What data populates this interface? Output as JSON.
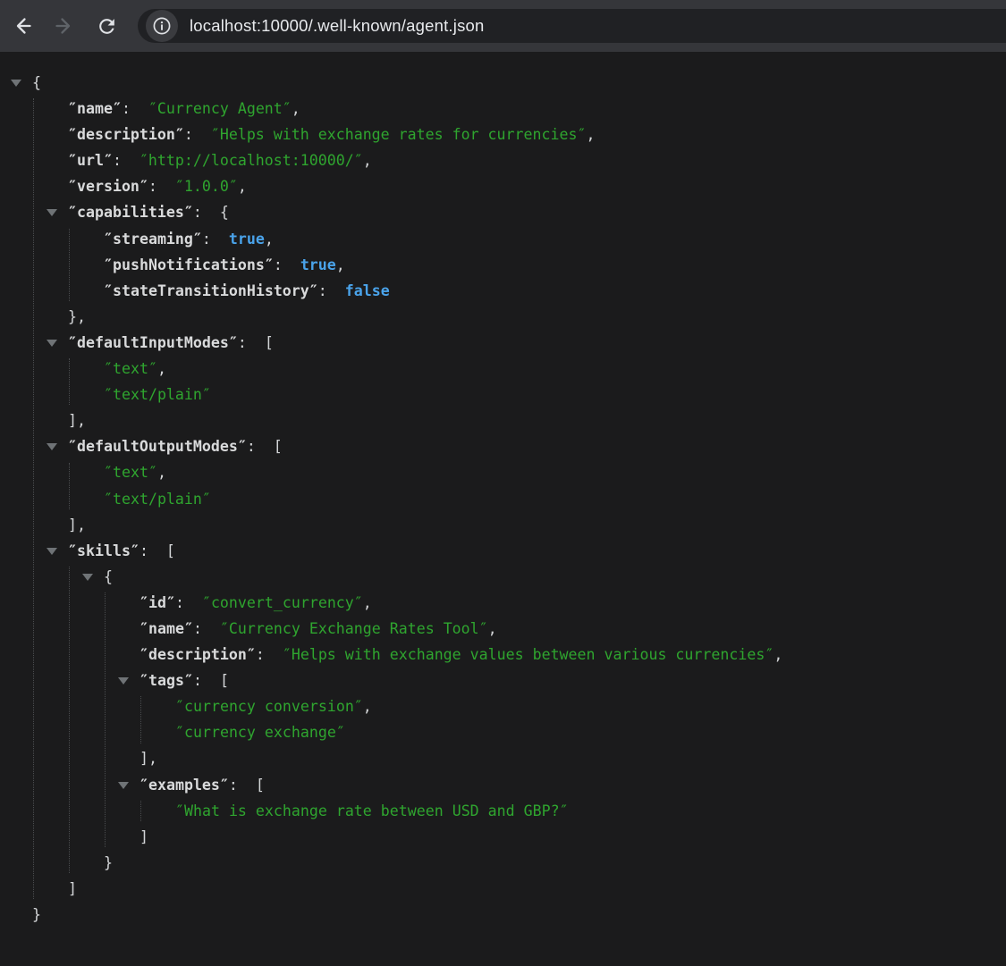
{
  "browser": {
    "toolbar": {
      "back_icon": "back-arrow-icon",
      "forward_icon": "forward-arrow-icon",
      "reload_icon": "reload-icon"
    },
    "omnibox": {
      "site_info_icon": "info-icon",
      "url": "localhost:10000/.well-known/agent.json"
    }
  },
  "viewer": {
    "quote_glyph": "″",
    "colors": {
      "toolbar_bg": "#35363a",
      "omnibox_bg": "#202124",
      "chip_bg": "#3a3b3f",
      "content_bg": "#1b1b1c",
      "url_text": "#e8eaed",
      "icon_bright": "#dfe1e5",
      "icon_dim": "#5f6368",
      "key": "#d9dadb",
      "string": "#2fa52f",
      "boolean": "#4aa3ea",
      "punctuation": "#d3d5d7",
      "toggle": "#6f7376",
      "guide": "#4a4c4e"
    }
  },
  "json_document": {
    "name": "Currency Agent",
    "description": "Helps with exchange rates for currencies",
    "url": "http://localhost:10000/",
    "version": "1.0.0",
    "capabilities": {
      "streaming": true,
      "pushNotifications": true,
      "stateTransitionHistory": false
    },
    "defaultInputModes": [
      "text",
      "text/plain"
    ],
    "defaultOutputModes": [
      "text",
      "text/plain"
    ],
    "skills": [
      {
        "id": "convert_currency",
        "name": "Currency Exchange Rates Tool",
        "description": "Helps with exchange values between various currencies",
        "tags": [
          "currency conversion",
          "currency exchange"
        ],
        "examples": [
          "What is exchange rate between USD and GBP?"
        ]
      }
    ]
  }
}
